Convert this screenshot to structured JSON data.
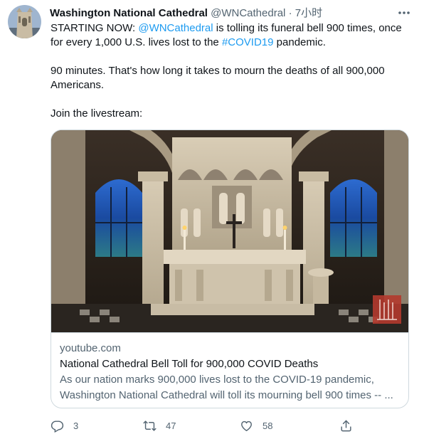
{
  "tweet": {
    "author_name": "Washington National Cathedral",
    "author_handle": "@WNCathedral",
    "separator": "·",
    "time": "7小时",
    "body": {
      "p1_start": "STARTING NOW: ",
      "mention": "@WNCathedral",
      "p1_mid": " is tolling its funeral bell 900 times, once for every 1,000 U.S. lives lost to the ",
      "hashtag": "#COVID19",
      "p1_end": " pandemic.",
      "p2": "90 minutes. That's how long it takes to mourn the deaths of all 900,000 Americans.",
      "p3": "Join the livestream:"
    }
  },
  "card": {
    "domain": "youtube.com",
    "title": "National Cathedral Bell Toll for 900,000 COVID Deaths",
    "description_line1": "As our nation marks 900,000 lives lost to the COVID-19 pandemic,",
    "description_line2": "Washington National Cathedral will toll its mourning bell 900 times -- ..."
  },
  "actions": {
    "reply_count": "3",
    "retweet_count": "47",
    "like_count": "58"
  },
  "icons": {
    "more": "more-dots-icon",
    "reply": "reply-icon",
    "retweet": "retweet-icon",
    "like": "heart-icon",
    "share": "share-icon"
  },
  "colors": {
    "link": "#1d9bf0",
    "secondary_text": "#536471",
    "border": "#cfd9de"
  }
}
